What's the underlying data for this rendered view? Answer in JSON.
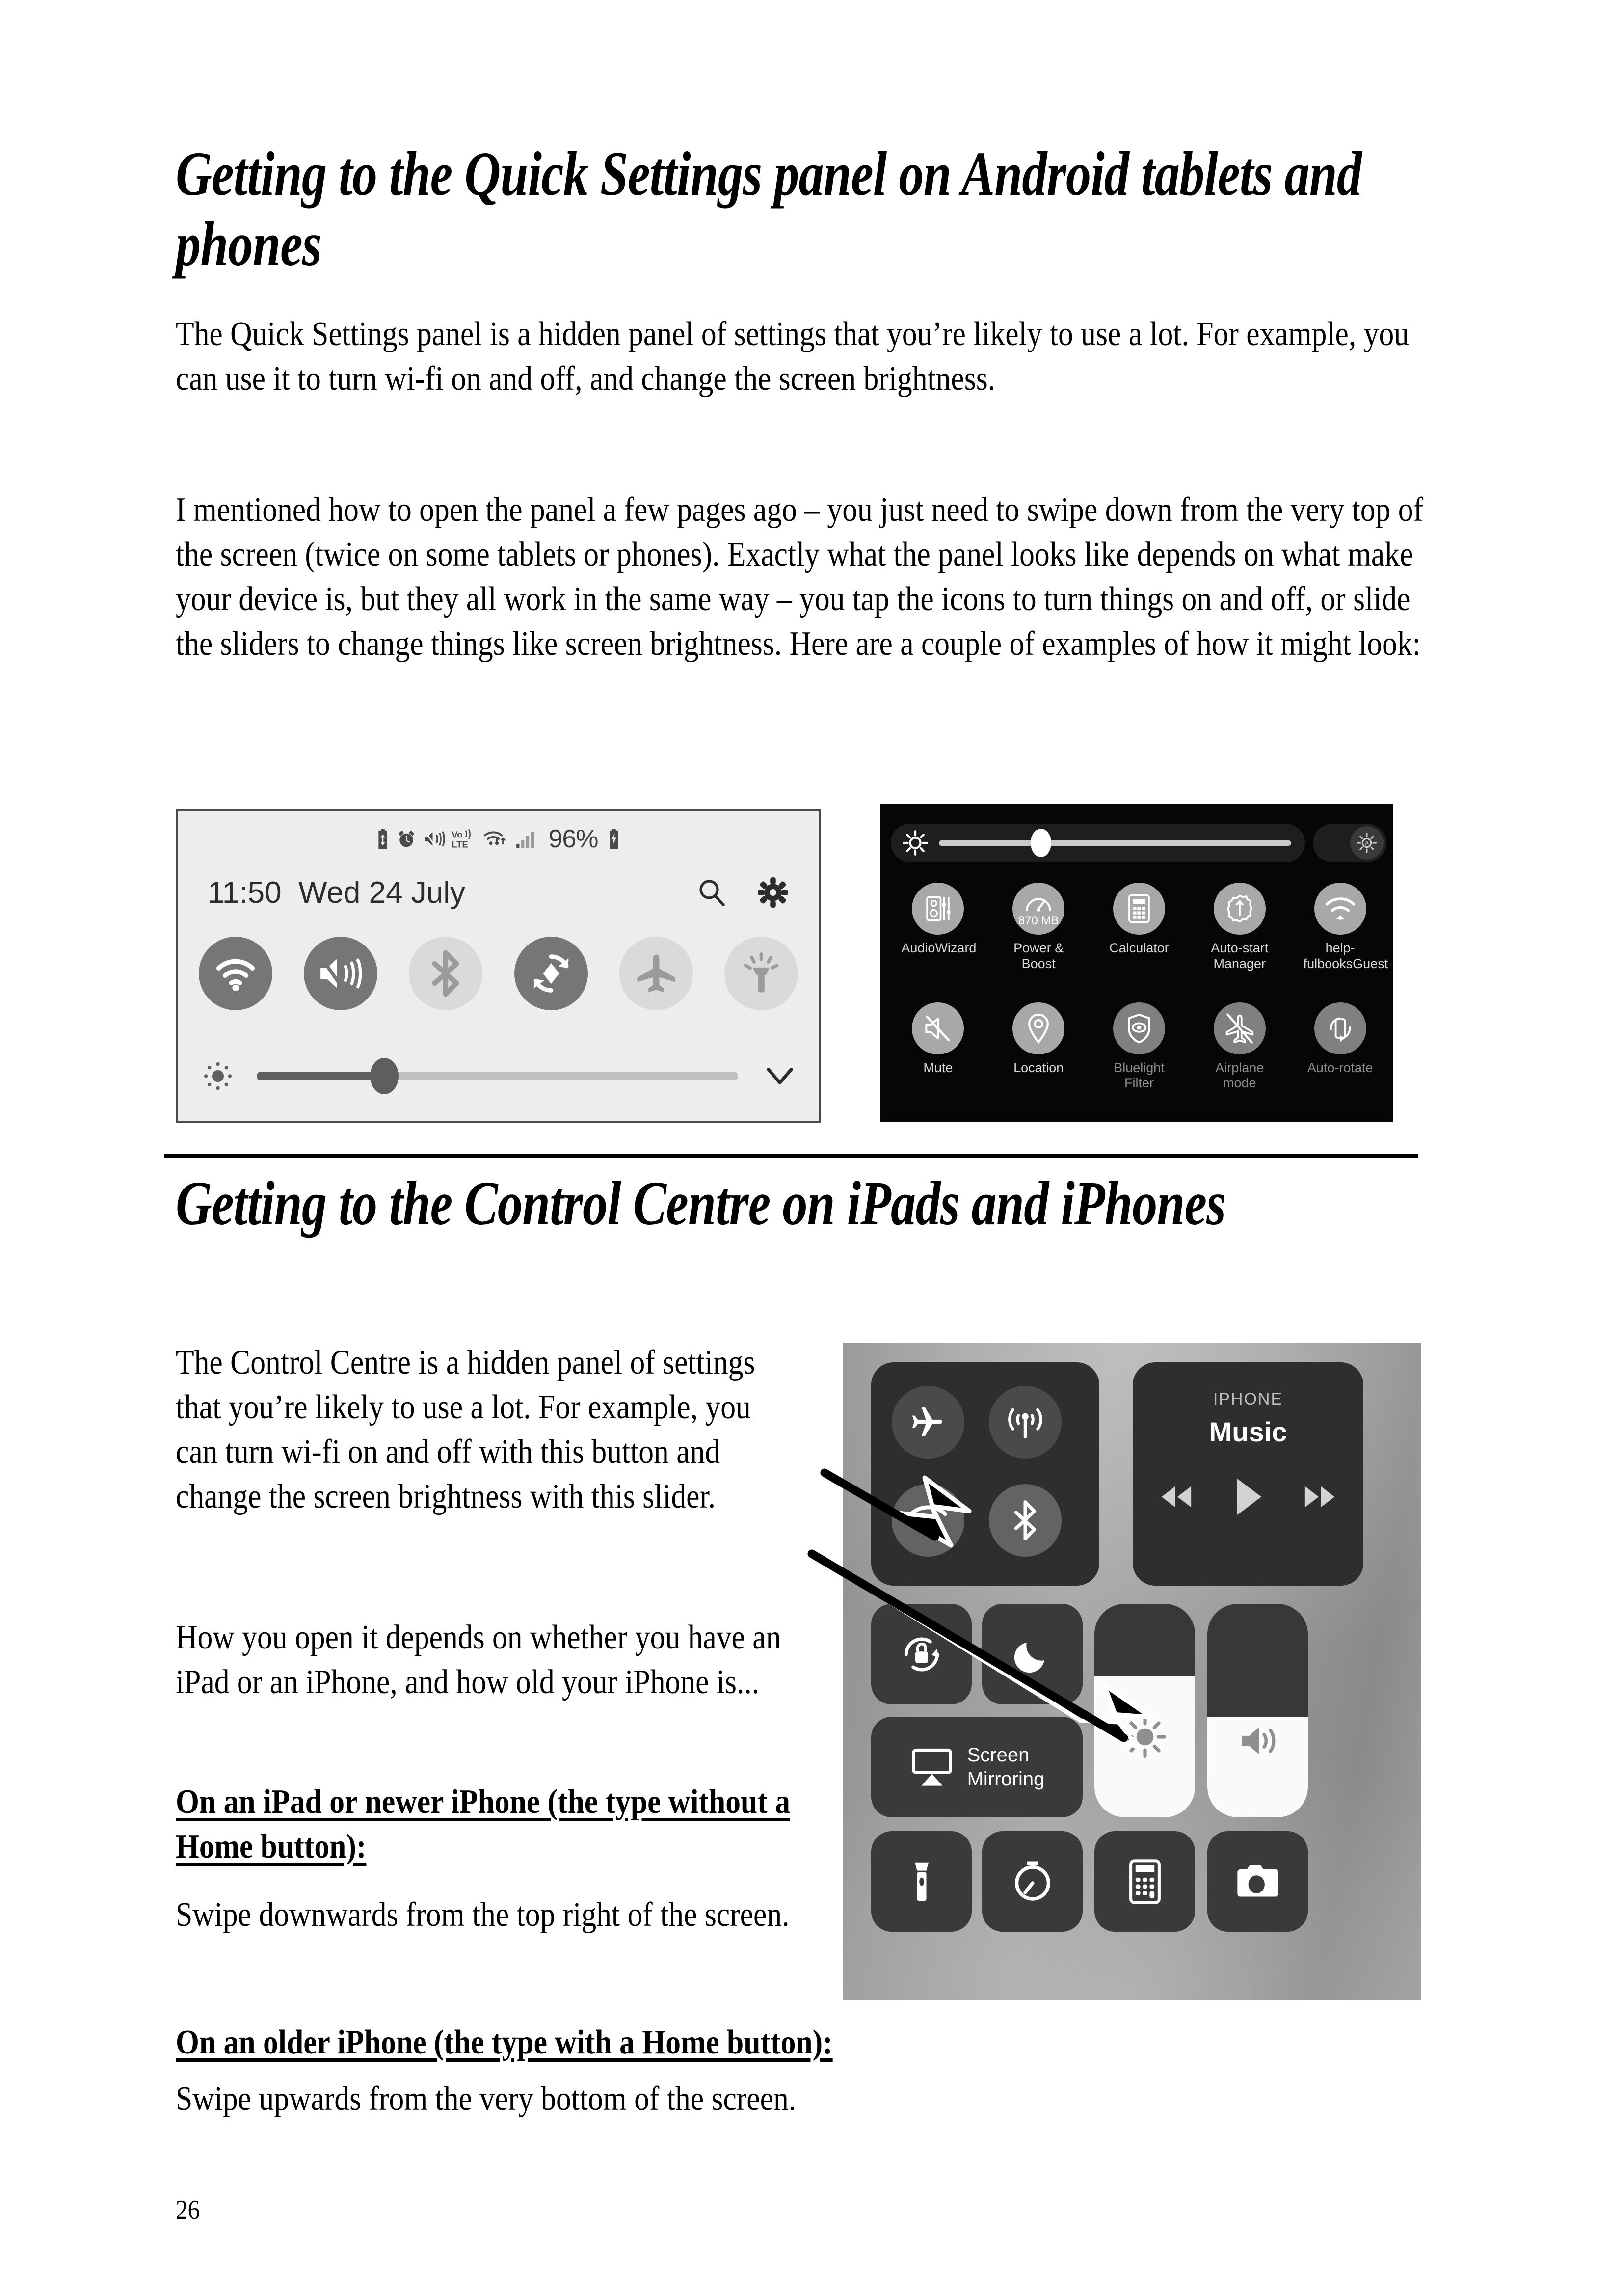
{
  "document": {
    "page_number": "26"
  },
  "section_android": {
    "heading": "Getting to the Quick Settings panel on Android tablets and phones",
    "paragraph_1": "The Quick Settings panel is a hidden panel of settings that you’re likely to use a lot.  For example, you can use it to turn wi-fi on and off, and change the screen brightness.",
    "paragraph_2": "I mentioned how to open the panel a few pages ago – you just need to swipe down from the very top of the screen (twice on some tablets or phones).  Exactly what the panel looks like depends on what make your device is, but they all work in the same way – you tap the icons to turn things on and off, or slide the sliders to change things like screen brightness.  Here are a couple of examples of how it might look:"
  },
  "android_panel": {
    "status_bar": {
      "icons": [
        "battery-saver-icon",
        "alarm-icon",
        "vibrate-mute-icon",
        "volte-icon",
        "wifi-data-icon",
        "signal-bars-icon"
      ],
      "volte_label": "Vo))\nLTE",
      "battery_percent": "96%",
      "charging_icon": "charging-battery-icon"
    },
    "header": {
      "time": "11:50",
      "date": "Wed 24 July",
      "search_icon": "search-icon",
      "settings_icon": "gear-icon"
    },
    "toggles": [
      {
        "name": "wifi",
        "icon": "wifi-icon",
        "state": "on"
      },
      {
        "name": "sound-mute",
        "icon": "mute-vibrate-icon",
        "state": "on"
      },
      {
        "name": "bluetooth",
        "icon": "bluetooth-icon",
        "state": "off"
      },
      {
        "name": "auto-rotate",
        "icon": "rotate-icon",
        "state": "on"
      },
      {
        "name": "airplane",
        "icon": "airplane-icon",
        "state": "off"
      },
      {
        "name": "flashlight",
        "icon": "flashlight-icon",
        "state": "off"
      }
    ],
    "brightness": {
      "icon": "brightness-icon",
      "value_percent": 27,
      "expand_icon": "chevron-down-icon"
    }
  },
  "asus_panel": {
    "brightness": {
      "icon": "brightness-icon",
      "value_percent": 29,
      "auto_icon": "auto-brightness-icon"
    },
    "tiles": [
      {
        "label": "AudioWizard",
        "icon": "audio-wizard-icon",
        "dim": false,
        "badge": ""
      },
      {
        "label": "Power & Boost",
        "icon": "speedometer-icon",
        "dim": false,
        "badge": "870 MB"
      },
      {
        "label": "Calculator",
        "icon": "calculator-icon",
        "dim": false,
        "badge": ""
      },
      {
        "label": "Auto-start\nManager",
        "icon": "auto-start-icon",
        "dim": false,
        "badge": ""
      },
      {
        "label": "help-\nfulbooksGuest",
        "icon": "wifi-icon",
        "dim": false,
        "badge": ""
      },
      {
        "label": "Mute",
        "icon": "mute-icon",
        "dim": false,
        "badge": ""
      },
      {
        "label": "Location",
        "icon": "location-pin-icon",
        "dim": false,
        "badge": ""
      },
      {
        "label": "Bluelight Filter",
        "icon": "bluelight-filter-icon",
        "dim": true,
        "badge": ""
      },
      {
        "label": "Airplane mode",
        "icon": "airplane-off-icon",
        "dim": true,
        "badge": ""
      },
      {
        "label": "Auto-rotate",
        "icon": "auto-rotate-icon",
        "dim": true,
        "badge": ""
      }
    ]
  },
  "section_ios": {
    "heading": "Getting to the Control Centre on iPads and iPhones",
    "paragraph_1": "The Control Centre is a hidden panel of settings that you’re likely to use a lot.  For example, you can turn wi-fi on and off with this button and change the screen brightness with this slider.",
    "paragraph_2": "How you open it depends on whether you have an iPad or an iPhone, and how old your iPhone is...",
    "subhead_1": "On an iPad or newer iPhone (the type without a Home button):",
    "paragraph_3": "Swipe downwards from the top right of the screen.",
    "subhead_2": "On an older iPhone (the type with a Home button):",
    "paragraph_4": "Swipe upwards from the very bottom of the screen."
  },
  "ios_panel": {
    "connectivity": [
      {
        "name": "airplane-mode",
        "icon": "airplane-icon",
        "state": "off"
      },
      {
        "name": "cellular-data",
        "icon": "cellular-icon",
        "state": "off"
      },
      {
        "name": "wifi",
        "icon": "wifi-icon",
        "state": "on"
      },
      {
        "name": "bluetooth",
        "icon": "bluetooth-icon",
        "state": "on"
      }
    ],
    "music": {
      "device_label": "IPHONE",
      "title": "Music",
      "controls": [
        "rewind-icon",
        "play-icon",
        "fast-forward-icon"
      ]
    },
    "tiles": [
      {
        "name": "rotation-lock",
        "icon": "rotation-lock-icon"
      },
      {
        "name": "do-not-disturb",
        "icon": "moon-icon"
      }
    ],
    "screen_mirroring": {
      "label": "Screen\nMirroring",
      "icon": "screen-mirroring-icon"
    },
    "brightness_slider": {
      "icon": "brightness-icon",
      "value_percent": 66
    },
    "volume_slider": {
      "icon": "speaker-icon",
      "value_percent": 47
    },
    "bottom_tiles": [
      {
        "name": "flashlight",
        "icon": "flashlight-icon"
      },
      {
        "name": "timer",
        "icon": "timer-icon"
      },
      {
        "name": "calculator",
        "icon": "calculator-icon"
      },
      {
        "name": "camera",
        "icon": "camera-icon"
      }
    ]
  },
  "annotations": {
    "arrow_wifi": "arrow-to-wifi-button",
    "arrow_brightness": "arrow-to-brightness-slider"
  }
}
